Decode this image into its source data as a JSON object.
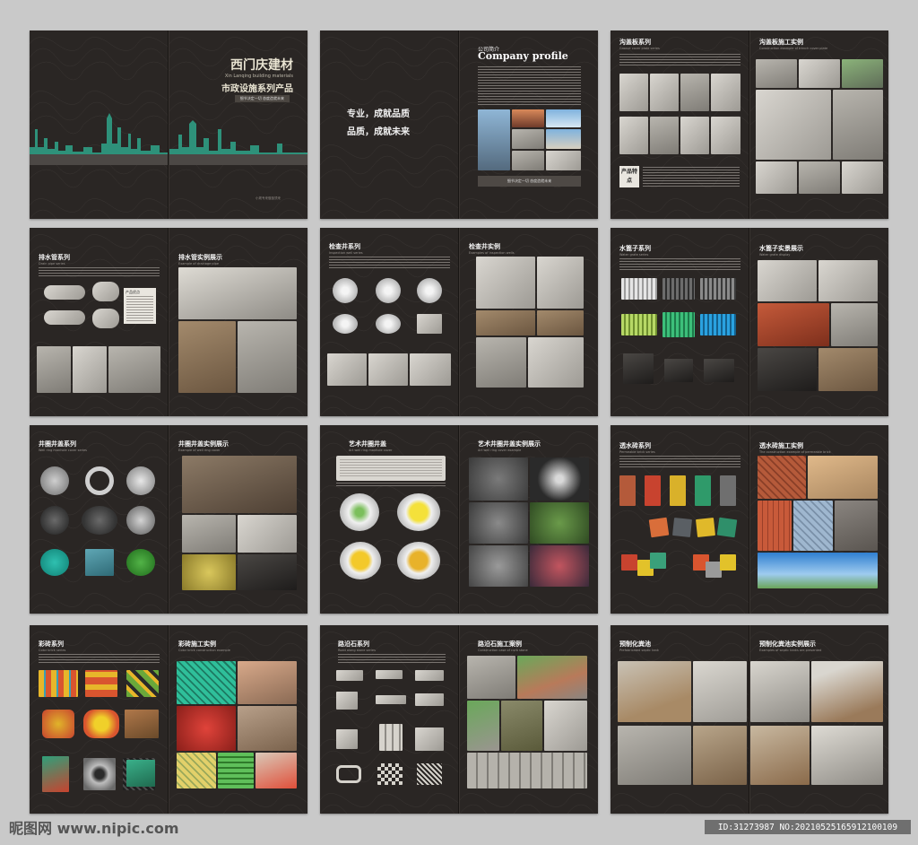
{
  "cover": {
    "title": "西门庆建材",
    "title_en": "Xin Lanqing building materials",
    "subtitle": "市政设施系列产品",
    "tagline": "细节决定一切  态度造就未来",
    "footer": "小规专来做极须来"
  },
  "intro": {
    "slogan_1": "专业，成就品质",
    "slogan_2": "品质，成就未来",
    "profile_cn": "公司简介",
    "profile_en": "Company profile",
    "banner": "细节决定一切  态度造就未来"
  },
  "pages": {
    "p3_left": {
      "title": "沟盖板系列",
      "sub": "Groove cover plate series",
      "feature": "产品特点"
    },
    "p3_right": {
      "title": "沟盖板施工实例",
      "sub": "Construction example of trench cover plate"
    },
    "p4_left": {
      "title": "排水管系列",
      "sub": "Drain pipe series",
      "panel": "产品优点"
    },
    "p4_right": {
      "title": "排水管实例展示",
      "sub": "Example of drainage pipe"
    },
    "p5_left": {
      "title": "检查井系列",
      "sub": "Inspection well series"
    },
    "p5_right": {
      "title": "检查井实例",
      "sub": "Examples of inspection wells"
    },
    "p6_left": {
      "title": "水篦子系列",
      "sub": "Water grate series"
    },
    "p6_right": {
      "title": "水篦子实景展示",
      "sub": "Water grate display"
    },
    "p7_left": {
      "title": "井圈井盖系列",
      "sub": "Well ring manhole cover series"
    },
    "p7_right": {
      "title": "井圈井盖实例展示",
      "sub": "Example of well ring cover"
    },
    "p8_left": {
      "title": "艺术井圈井盖",
      "sub": "Art well ring manhole cover"
    },
    "p8_right": {
      "title": "艺术井圈井盖实例展示",
      "sub": "Art well ring cover example"
    },
    "p9_left": {
      "title": "透水砖系列",
      "sub": "Permeable brick series"
    },
    "p9_right": {
      "title": "透水砖施工实例",
      "sub": "The construction example of permeable brick"
    },
    "p10_left": {
      "title": "彩砖系列",
      "sub": "Color brick series"
    },
    "p10_right": {
      "title": "彩砖施工实例",
      "sub": "Color brick construction example"
    },
    "p11_left": {
      "title": "路沿石系列",
      "sub": "Road along stone series"
    },
    "p11_right": {
      "title": "路沿石施工案例",
      "sub": "Construction case of curb stone"
    },
    "p12_left": {
      "title": "预制化粪池",
      "sub": "Prefabricated septic tank"
    },
    "p12_right": {
      "title": "预制化粪池实例展示",
      "sub": "Examples of septic tanks are presented"
    }
  },
  "footer": {
    "watermark": "昵图网 www.nipic.com",
    "id_text": "ID:31273987 NO:20210525165912100109"
  },
  "colors": {
    "page_bg": "#2a2624",
    "canvas_bg": "#c9c9c9",
    "skyline_teal": "#2fa58a"
  }
}
